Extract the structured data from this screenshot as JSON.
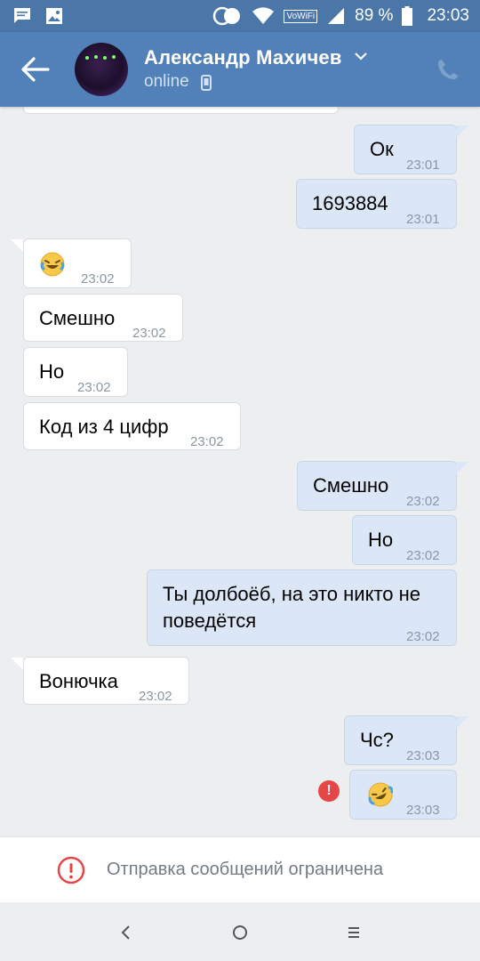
{
  "status_bar": {
    "vowifi": "VoWiFi",
    "battery": "89 %",
    "time": "23:03"
  },
  "header": {
    "contact_name": "Александр Махичев",
    "status": "online",
    "icons": [
      "back-arrow-icon",
      "chevron-down-icon",
      "phone-icon",
      "mobile-device-icon"
    ]
  },
  "messages": [
    {
      "dir": "out",
      "text": "Ок",
      "time": "23:01"
    },
    {
      "dir": "out",
      "text": "1693884",
      "time": "23:01"
    },
    {
      "dir": "in",
      "emoji": "face-with-tears-of-joy",
      "time": "23:02"
    },
    {
      "dir": "in",
      "text": "Смешно",
      "time": "23:02"
    },
    {
      "dir": "in",
      "text": "Но",
      "time": "23:02"
    },
    {
      "dir": "in",
      "text": "Код из 4 цифр",
      "time": "23:02"
    },
    {
      "dir": "out",
      "text": "Смешно",
      "time": "23:02"
    },
    {
      "dir": "out",
      "text": "Но",
      "time": "23:02"
    },
    {
      "dir": "out",
      "text": "Ты долбоёб, на это никто не поведётся",
      "time": "23:02"
    },
    {
      "dir": "in",
      "text": "Вонючка",
      "time": "23:02"
    },
    {
      "dir": "out",
      "text": "Чс?",
      "time": "23:03"
    },
    {
      "dir": "out",
      "emoji": "rolling-on-the-floor-laughing",
      "time": "23:03",
      "failed": true
    }
  ],
  "restriction": {
    "text": "Отправка сообщений ограничена"
  },
  "colors": {
    "header": "#5181b8",
    "status_bar": "#4a76a8",
    "out_bubble": "#dbe7f7",
    "in_bubble": "#ffffff",
    "error": "#e64646"
  }
}
